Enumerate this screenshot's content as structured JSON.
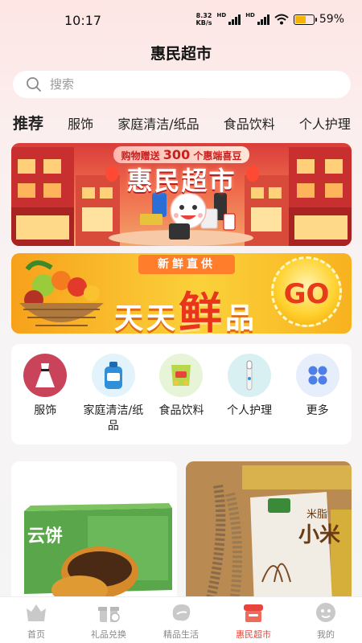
{
  "status_bar": {
    "time": "10:17",
    "net_speed_value": "8.32",
    "net_speed_unit": "KB/s",
    "hd1": "HD",
    "hd2": "HD",
    "battery_percent": "59%",
    "battery_level": 0.59
  },
  "header": {
    "title": "惠民超市"
  },
  "search": {
    "placeholder": "搜索"
  },
  "category_tabs": [
    {
      "label": "推荐",
      "active": true
    },
    {
      "label": "服饰"
    },
    {
      "label": "家庭清洁/纸品"
    },
    {
      "label": "食品饮料"
    },
    {
      "label": "个人护理"
    }
  ],
  "banner_market": {
    "promo_prefix": "购物赠送",
    "promo_number": "300",
    "promo_suffix": "个惠端喜豆",
    "title": "惠民超市"
  },
  "banner_fresh": {
    "tag": "新鲜直供",
    "text_a": "天天",
    "text_big": "鲜",
    "text_b": "品",
    "go": "GO"
  },
  "icon_grid": [
    {
      "label": "服饰",
      "icon": "dress-icon"
    },
    {
      "label": "家庭清洁/纸品",
      "icon": "detergent-icon"
    },
    {
      "label": "食品饮料",
      "icon": "snack-icon"
    },
    {
      "label": "个人护理",
      "icon": "toothbrush-icon"
    },
    {
      "label": "更多",
      "icon": "more-grid-icon"
    }
  ],
  "products": {
    "card1_box_text": "云饼",
    "card2_bag_text": "小米",
    "card2_bag_sub": "米脂"
  },
  "tabbar": [
    {
      "label": "首页",
      "icon": "home-icon"
    },
    {
      "label": "礼品兑换",
      "icon": "gift-icon"
    },
    {
      "label": "精品生活",
      "icon": "bean-icon"
    },
    {
      "label": "惠民超市",
      "icon": "shop-icon",
      "active": true
    },
    {
      "label": "我的",
      "icon": "profile-icon"
    }
  ],
  "colors": {
    "accent": "#e8443c",
    "banner_red": "#d93d3a",
    "banner_orange": "#f7a11b"
  }
}
